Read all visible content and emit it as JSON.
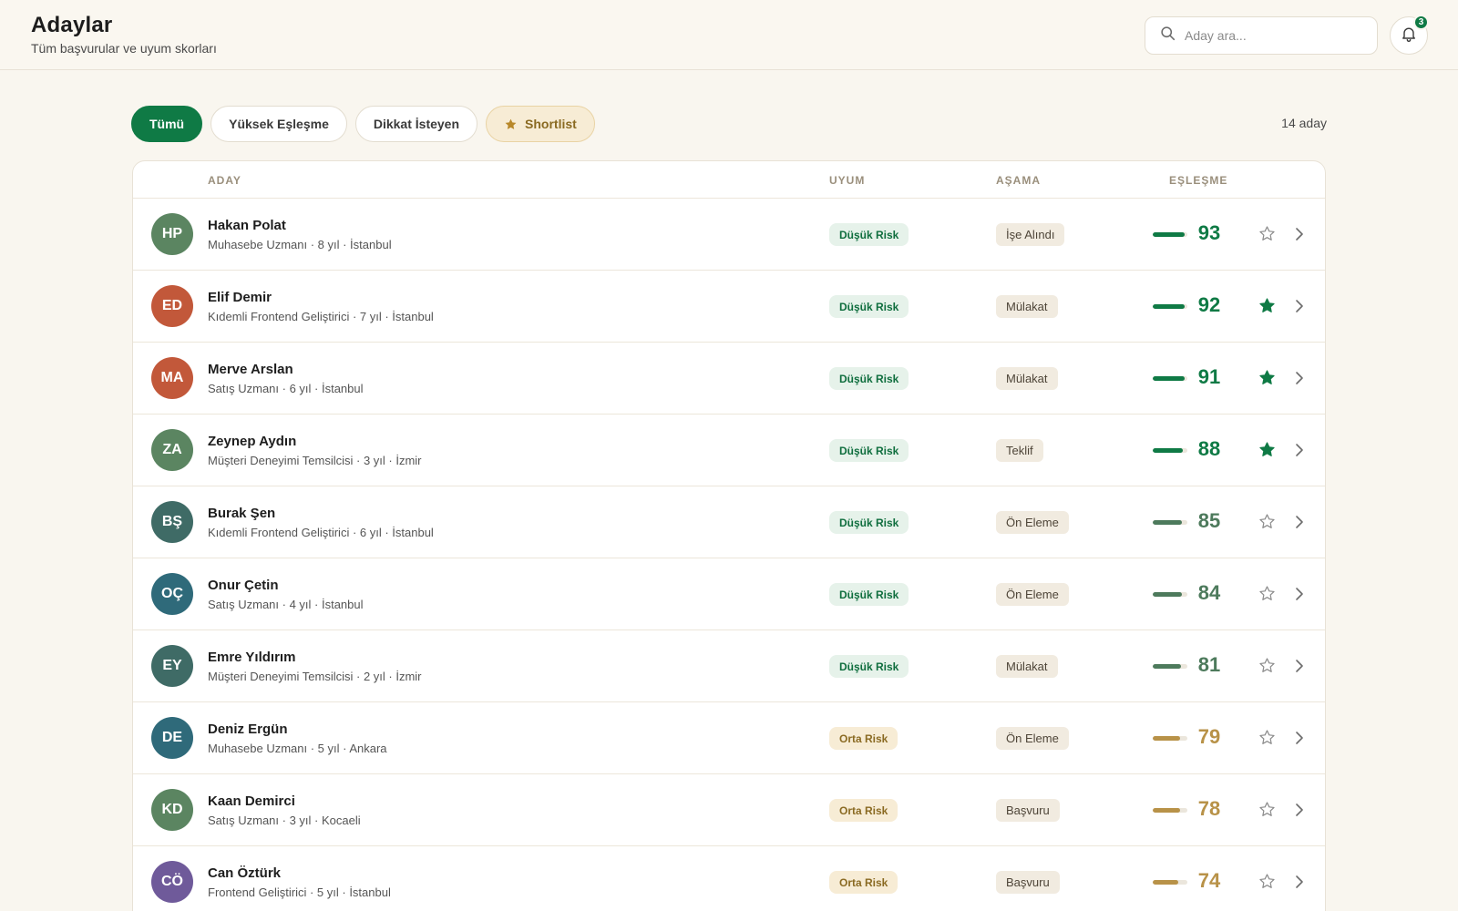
{
  "header": {
    "title": "Adaylar",
    "subtitle": "Tüm başvurular ve uyum skorları",
    "search_placeholder": "Aday ara...",
    "notification_count": "3"
  },
  "filters": {
    "all": "Tümü",
    "high_match": "Yüksek Eşleşme",
    "attention": "Dikkat İsteyen",
    "shortlist": "Shortlist",
    "active": "all"
  },
  "count_label": "14 aday",
  "table": {
    "headers": {
      "candidate": "ADAY",
      "fit": "UYUM",
      "stage": "AŞAMA",
      "match": "EŞLEŞME"
    },
    "rows": [
      {
        "initials": "HP",
        "name": "Hakan Polat",
        "meta": "Muhasebe Uzmanı · 8 yıl · İstanbul",
        "risk": "Düşük Risk",
        "risk_level": "low",
        "stage": "İşe Alındı",
        "score": "93",
        "starred": false,
        "avatar_color": "#5b8561"
      },
      {
        "initials": "ED",
        "name": "Elif Demir",
        "meta": "Kıdemli Frontend Geliştirici · 7 yıl · İstanbul",
        "risk": "Düşük Risk",
        "risk_level": "low",
        "stage": "Mülakat",
        "score": "92",
        "starred": true,
        "avatar_color": "#c2583a"
      },
      {
        "initials": "MA",
        "name": "Merve Arslan",
        "meta": "Satış Uzmanı · 6 yıl · İstanbul",
        "risk": "Düşük Risk",
        "risk_level": "low",
        "stage": "Mülakat",
        "score": "91",
        "starred": true,
        "avatar_color": "#c2583a"
      },
      {
        "initials": "ZA",
        "name": "Zeynep Aydın",
        "meta": "Müşteri Deneyimi Temsilcisi · 3 yıl · İzmir",
        "risk": "Düşük Risk",
        "risk_level": "low",
        "stage": "Teklif",
        "score": "88",
        "starred": true,
        "avatar_color": "#5b8561"
      },
      {
        "initials": "BŞ",
        "name": "Burak Şen",
        "meta": "Kıdemli Frontend Geliştirici · 6 yıl · İstanbul",
        "risk": "Düşük Risk",
        "risk_level": "low",
        "stage": "Ön Eleme",
        "score": "85",
        "starred": false,
        "avatar_color": "#3f6b66"
      },
      {
        "initials": "OÇ",
        "name": "Onur Çetin",
        "meta": "Satış Uzmanı · 4 yıl · İstanbul",
        "risk": "Düşük Risk",
        "risk_level": "low",
        "stage": "Ön Eleme",
        "score": "84",
        "starred": false,
        "avatar_color": "#2f6a7a"
      },
      {
        "initials": "EY",
        "name": "Emre Yıldırım",
        "meta": "Müşteri Deneyimi Temsilcisi · 2 yıl · İzmir",
        "risk": "Düşük Risk",
        "risk_level": "low",
        "stage": "Mülakat",
        "score": "81",
        "starred": false,
        "avatar_color": "#3f6b66"
      },
      {
        "initials": "DE",
        "name": "Deniz Ergün",
        "meta": "Muhasebe Uzmanı · 5 yıl · Ankara",
        "risk": "Orta Risk",
        "risk_level": "mid",
        "stage": "Ön Eleme",
        "score": "79",
        "starred": false,
        "avatar_color": "#2f6a7a"
      },
      {
        "initials": "KD",
        "name": "Kaan Demirci",
        "meta": "Satış Uzmanı · 3 yıl · Kocaeli",
        "risk": "Orta Risk",
        "risk_level": "mid",
        "stage": "Başvuru",
        "score": "78",
        "starred": false,
        "avatar_color": "#5b8561"
      },
      {
        "initials": "CÖ",
        "name": "Can Öztürk",
        "meta": "Frontend Geliştirici · 5 yıl · İstanbul",
        "risk": "Orta Risk",
        "risk_level": "mid",
        "stage": "Başvuru",
        "score": "74",
        "starred": false,
        "avatar_color": "#6f5a9a"
      }
    ]
  },
  "colors": {
    "accent": "#0f7a45",
    "score_high": "#0f7a45",
    "score_mid": "#4d7a5c",
    "score_warn": "#b89248",
    "bar_high": "#0f7a45",
    "bar_mid": "#4d7a5c",
    "bar_warn": "#b89248"
  }
}
